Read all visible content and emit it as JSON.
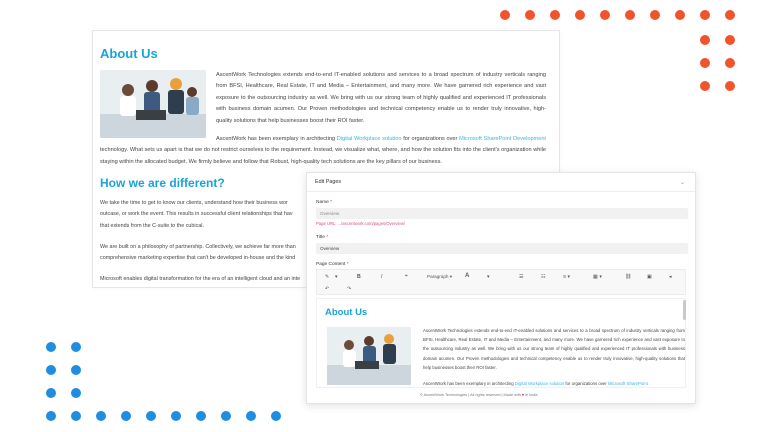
{
  "about": {
    "title": "About Us",
    "intro": "AscentWork Technologies extends end-to-end IT-enabled solutions and services to a broad spectrum of industry verticals ranging from BFSI, Healthcare, Real Estate, IT and Media – Entertainment, and many more. We have garnered rich experience and vast exposure to the outsourcing industry as well. We bring with us our strong team of highly qualified and experienced IT professionals with business domain acumen. Our Proven methodologies and technical competency enable us to render truly innovative, high-quality solutions that help businesses boost their ROI faster.",
    "ex_pre": "AscentWork has been exemplary in architecting ",
    "ex_link1": "Digital Workplace solution",
    "ex_mid": " for organizations over ",
    "ex_link2": "Microsoft SharePoint Development",
    "ex_post": " technology. What sets us apart is that we do not restrict ourselves to the requirement. Instead, we visualize what, where, and how the solution fits into the client's organization while staying within the allocated budget. We firmly believe and follow that Robust, high-quality tech solutions are the key pillars of our business."
  },
  "different": {
    "title": "How we are different?",
    "p1_l1": "We take the time to get to know our clients, understand how their business wor",
    "p1_l2": "outcase, or work the event. This results in successful client relationships that hav",
    "p1_l3": "that extends from the C-suite to the cubical.",
    "p2_l1": "We are built on a philosophy of partnership. Collectively, we achieve far more than",
    "p2_l2": "comprehensive marketing expertise that can't be developed in-house and the kind",
    "p3_l1": "Microsoft enables digital transformation for the era of an intelligent cloud and an inte"
  },
  "panel": {
    "title": "Edit Pages",
    "name_label": "Name",
    "name_value": "Overview",
    "name_hint": "Page URL: .../ascentwork.com/pages/Overview/",
    "title_label": "Title",
    "title_value": "Overview",
    "content_label": "Page Content",
    "toolbar": {
      "paragraph": "Paragraph",
      "bold": "B",
      "italic": "I",
      "quote": "❝",
      "text": "A",
      "undo": "↶",
      "redo": "↷"
    },
    "editor": {
      "heading": "About Us",
      "p1": "AscentWork Technologies extends end-to-end IT-enabled solutions and services to a broad spectrum of industry verticals ranging from BFSI, Healthcare, Real Estate, IT and Media – Entertainment, and many more. We have garnered rich experience and vast exposure to the outsourcing industry as well. We bring with us our strong team of highly qualified and experienced IT professionals with business domain acumen. Our Proven methodologies and technical competency enable us to render truly innovative, high-quality solutions that help businesses boost their ROI faster.",
      "p2_pre": "AscentWork has been exemplary in architecting ",
      "p2_link1": "Digital Workplace solution",
      "p2_mid": " for organizations over ",
      "p2_link2": "Microsoft SharePoint"
    },
    "footer_pre": "© AscentWork Technologies | All rights reserved | Made with ",
    "footer_heart": "♥",
    "footer_post": " in India"
  },
  "colors": {
    "accent": "#1aa3d9",
    "link": "#3bb3e2",
    "dot_orange": "#f0542d",
    "dot_blue": "#1f8de0"
  }
}
